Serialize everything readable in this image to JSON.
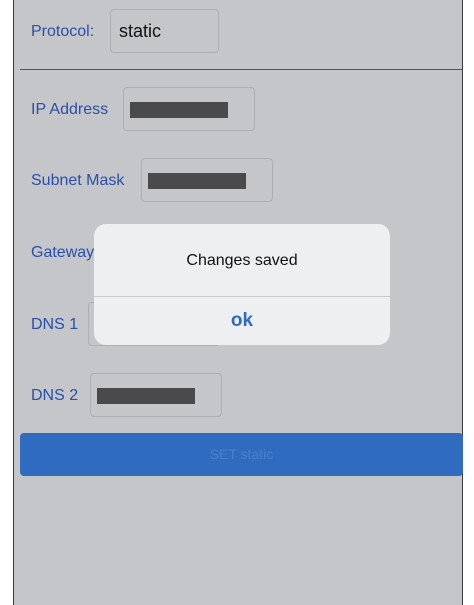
{
  "protocol": {
    "label": "Protocol:",
    "value": "static"
  },
  "ip_address": {
    "label": "IP Address"
  },
  "subnet_mask": {
    "label": "Subnet Mask"
  },
  "gateway": {
    "label": "Gateway"
  },
  "dns1": {
    "label": "DNS 1"
  },
  "dns2": {
    "label": "DNS 2"
  },
  "set_button": {
    "label": "SET static"
  },
  "dialog": {
    "message": "Changes saved",
    "ok_label": "ok"
  },
  "colors": {
    "background": "#c5c6c9",
    "accent": "#2f6cc0",
    "label": "#2a4fa8",
    "redaction": "#4a4a4c",
    "dialog": "#eeeff1"
  }
}
